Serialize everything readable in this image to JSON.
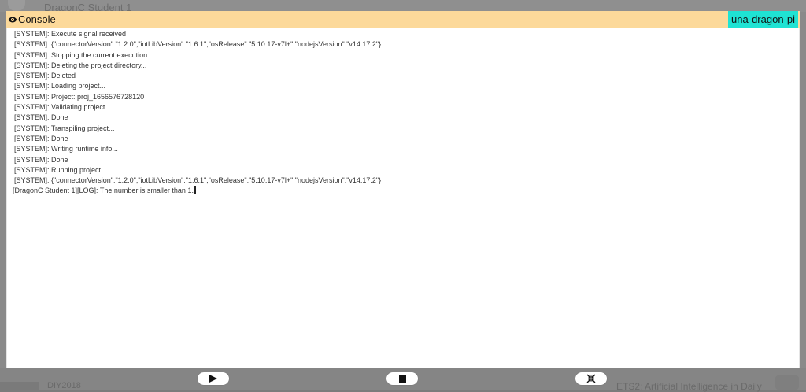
{
  "background": {
    "app_title": "DragonC Student 1",
    "bottom_left_text": "DIY2018",
    "bottom_right_text": "ETS2: Artificial Intelligence in Daily"
  },
  "console": {
    "title": "Console",
    "device_name": "una-dragon-pi",
    "header_color": "#fcd99a",
    "badge_color": "#1fe3d3",
    "lines": [
      "[SYSTEM]: Execute signal received",
      "[SYSTEM]: {\"connectorVersion\":\"1.2.0\",\"iotLibVersion\":\"1.6.1\",\"osRelease\":\"5.10.17-v7l+\",\"nodejsVersion\":\"v14.17.2\"}",
      "[SYSTEM]: Stopping the current execution...",
      "[SYSTEM]: Deleting the project directory...",
      "[SYSTEM]: Deleted",
      "[SYSTEM]: Loading project...",
      "[SYSTEM]: Project: proj_1656576728120",
      "[SYSTEM]: Validating project...",
      "[SYSTEM]: Done",
      "[SYSTEM]: Transpiling project...",
      "[SYSTEM]: Done",
      "[SYSTEM]: Writing runtime info...",
      "[SYSTEM]: Done",
      "[SYSTEM]: Running project...",
      "[SYSTEM]: {\"connectorVersion\":\"1.2.0\",\"iotLibVersion\":\"1.6.1\",\"osRelease\":\"5.10.17-v7l+\",\"nodejsVersion\":\"v14.17.2\"}"
    ],
    "user_log": "[DragonC Student 1][LOG]: The number is smaller than 1."
  },
  "controls": {
    "play_icon": "play-icon",
    "stop_icon": "stop-icon",
    "collapse_icon": "collapse-icon"
  }
}
